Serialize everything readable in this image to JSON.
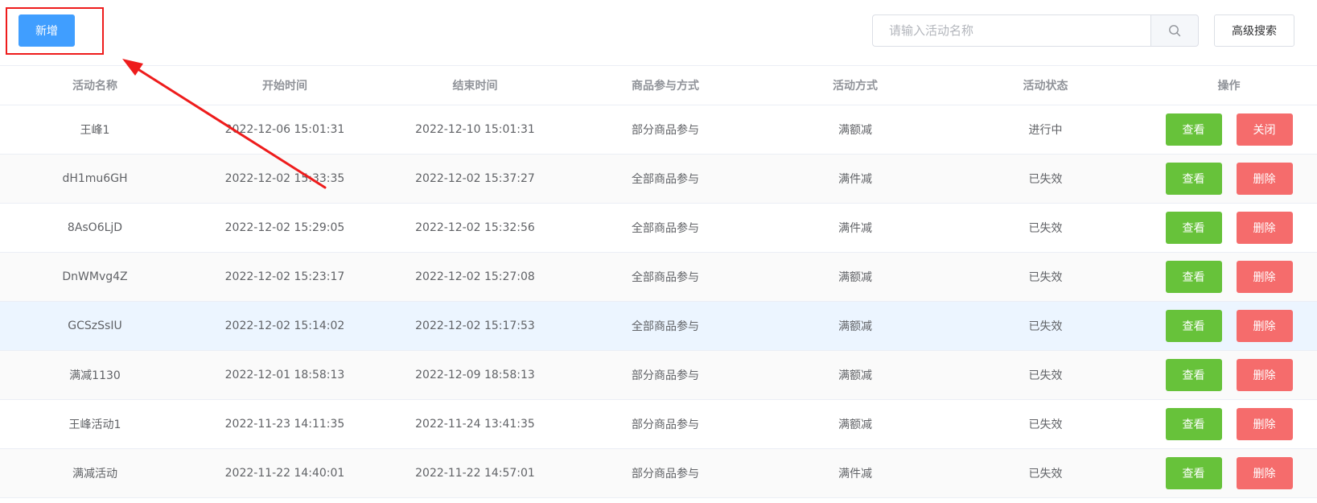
{
  "toolbar": {
    "add_label": "新增",
    "search_placeholder": "请输入活动名称",
    "search_value": "",
    "advanced_search_label": "高级搜索"
  },
  "table": {
    "headers": [
      "活动名称",
      "开始时间",
      "结束时间",
      "商品参与方式",
      "活动方式",
      "活动状态",
      "操作"
    ],
    "rows": [
      {
        "name": "王峰1",
        "start": "2022-12-06 15:01:31",
        "end": "2022-12-10 15:01:31",
        "participation": "部分商品参与",
        "method": "满额减",
        "status": "进行中",
        "view_label": "查看",
        "action_label": "关闭"
      },
      {
        "name": "dH1mu6GH",
        "start": "2022-12-02 15:33:35",
        "end": "2022-12-02 15:37:27",
        "participation": "全部商品参与",
        "method": "满件减",
        "status": "已失效",
        "view_label": "查看",
        "action_label": "删除"
      },
      {
        "name": "8AsO6LjD",
        "start": "2022-12-02 15:29:05",
        "end": "2022-12-02 15:32:56",
        "participation": "全部商品参与",
        "method": "满件减",
        "status": "已失效",
        "view_label": "查看",
        "action_label": "删除"
      },
      {
        "name": "DnWMvg4Z",
        "start": "2022-12-02 15:23:17",
        "end": "2022-12-02 15:27:08",
        "participation": "全部商品参与",
        "method": "满额减",
        "status": "已失效",
        "view_label": "查看",
        "action_label": "删除"
      },
      {
        "name": "GCSzSsIU",
        "start": "2022-12-02 15:14:02",
        "end": "2022-12-02 15:17:53",
        "participation": "全部商品参与",
        "method": "满额减",
        "status": "已失效",
        "view_label": "查看",
        "action_label": "删除"
      },
      {
        "name": "满减1130",
        "start": "2022-12-01 18:58:13",
        "end": "2022-12-09 18:58:13",
        "participation": "部分商品参与",
        "method": "满额减",
        "status": "已失效",
        "view_label": "查看",
        "action_label": "删除"
      },
      {
        "name": "王峰活动1",
        "start": "2022-11-23 14:11:35",
        "end": "2022-11-24 13:41:35",
        "participation": "部分商品参与",
        "method": "满额减",
        "status": "已失效",
        "view_label": "查看",
        "action_label": "删除"
      },
      {
        "name": "满减活动",
        "start": "2022-11-22 14:40:01",
        "end": "2022-11-22 14:57:01",
        "participation": "部分商品参与",
        "method": "满件减",
        "status": "已失效",
        "view_label": "查看",
        "action_label": "删除"
      }
    ]
  },
  "colors": {
    "primary": "#409eff",
    "success": "#67c23a",
    "danger": "#f56c6c",
    "annotation": "#ee1c1c"
  },
  "icons": {
    "search": "search-icon"
  }
}
